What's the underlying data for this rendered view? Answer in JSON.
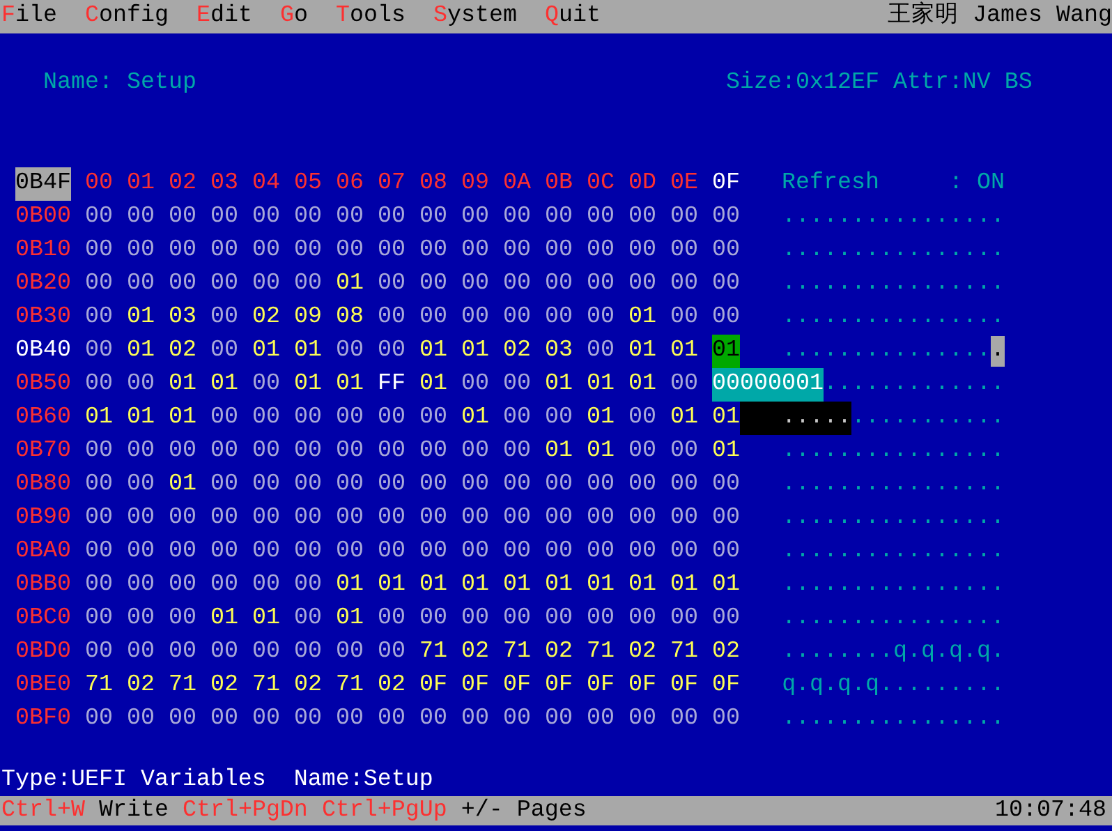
{
  "menu": [
    {
      "label": "File"
    },
    {
      "label": "Config"
    },
    {
      "label": "Edit"
    },
    {
      "label": "Go"
    },
    {
      "label": "Tools"
    },
    {
      "label": "System"
    },
    {
      "label": "Quit"
    }
  ],
  "user": "王家明 James Wang",
  "variable": {
    "name": "Name: Setup",
    "info": "Size:0x12EF Attr:NV BS"
  },
  "header": {
    "offset": "0B4F",
    "columns": [
      {
        "label": "00",
        "selected": false
      },
      {
        "label": "01",
        "selected": false
      },
      {
        "label": "02",
        "selected": false
      },
      {
        "label": "03",
        "selected": false
      },
      {
        "label": "04",
        "selected": false
      },
      {
        "label": "05",
        "selected": false
      },
      {
        "label": "06",
        "selected": false
      },
      {
        "label": "07",
        "selected": false
      },
      {
        "label": "08",
        "selected": false
      },
      {
        "label": "09",
        "selected": false
      },
      {
        "label": "0A",
        "selected": false
      },
      {
        "label": "0B",
        "selected": false
      },
      {
        "label": "0C",
        "selected": false
      },
      {
        "label": "0D",
        "selected": false
      },
      {
        "label": "0E",
        "selected": false
      },
      {
        "label": "0F",
        "selected": true
      }
    ],
    "refresh_label": "Refresh",
    "refresh_value": ": ON"
  },
  "rows": [
    {
      "offset": "0B00",
      "selected": false,
      "bytes": [
        "00",
        "00",
        "00",
        "00",
        "00",
        "00",
        "00",
        "00",
        "00",
        "00",
        "00",
        "00",
        "00",
        "00",
        "00",
        "00"
      ],
      "ascii": "................"
    },
    {
      "offset": "0B10",
      "selected": false,
      "bytes": [
        "00",
        "00",
        "00",
        "00",
        "00",
        "00",
        "00",
        "00",
        "00",
        "00",
        "00",
        "00",
        "00",
        "00",
        "00",
        "00"
      ],
      "ascii": "................"
    },
    {
      "offset": "0B20",
      "selected": false,
      "bytes": [
        "00",
        "00",
        "00",
        "00",
        "00",
        "00",
        "01",
        "00",
        "00",
        "00",
        "00",
        "00",
        "00",
        "00",
        "00",
        "00"
      ],
      "ascii": "................"
    },
    {
      "offset": "0B30",
      "selected": false,
      "bytes": [
        "00",
        "01",
        "03",
        "00",
        "02",
        "09",
        "08",
        "00",
        "00",
        "00",
        "00",
        "00",
        "00",
        "01",
        "00",
        "00"
      ],
      "ascii": "................"
    },
    {
      "offset": "0B40",
      "selected": true,
      "bytes": [
        "00",
        "01",
        "02",
        "00",
        "01",
        "01",
        "00",
        "00",
        "01",
        "01",
        "02",
        "03",
        "00",
        "01",
        "01",
        "01"
      ],
      "ascii": "................"
    },
    {
      "offset": "0B50",
      "selected": false,
      "bytes": [
        "00",
        "00",
        "01",
        "01",
        "00",
        "01",
        "01",
        "FF",
        "01",
        "00",
        "00",
        "01",
        "01",
        "01",
        "00"
      ],
      "ascii": "............."
    },
    {
      "offset": "0B60",
      "selected": false,
      "bytes": [
        "01",
        "01",
        "01",
        "00",
        "00",
        "00",
        "00",
        "00",
        "00",
        "01",
        "00",
        "00",
        "01",
        "00",
        "01",
        "01"
      ],
      "ascii": "................"
    },
    {
      "offset": "0B70",
      "selected": false,
      "bytes": [
        "00",
        "00",
        "00",
        "00",
        "00",
        "00",
        "00",
        "00",
        "00",
        "00",
        "00",
        "01",
        "01",
        "00",
        "00",
        "01"
      ],
      "ascii": "................"
    },
    {
      "offset": "0B80",
      "selected": false,
      "bytes": [
        "00",
        "00",
        "01",
        "00",
        "00",
        "00",
        "00",
        "00",
        "00",
        "00",
        "00",
        "00",
        "00",
        "00",
        "00",
        "00"
      ],
      "ascii": "................"
    },
    {
      "offset": "0B90",
      "selected": false,
      "bytes": [
        "00",
        "00",
        "00",
        "00",
        "00",
        "00",
        "00",
        "00",
        "00",
        "00",
        "00",
        "00",
        "00",
        "00",
        "00",
        "00"
      ],
      "ascii": "................"
    },
    {
      "offset": "0BA0",
      "selected": false,
      "bytes": [
        "00",
        "00",
        "00",
        "00",
        "00",
        "00",
        "00",
        "00",
        "00",
        "00",
        "00",
        "00",
        "00",
        "00",
        "00",
        "00"
      ],
      "ascii": "................"
    },
    {
      "offset": "0BB0",
      "selected": false,
      "bytes": [
        "00",
        "00",
        "00",
        "00",
        "00",
        "00",
        "01",
        "01",
        "01",
        "01",
        "01",
        "01",
        "01",
        "01",
        "01",
        "01"
      ],
      "ascii": "................"
    },
    {
      "offset": "0BC0",
      "selected": false,
      "bytes": [
        "00",
        "00",
        "00",
        "01",
        "01",
        "00",
        "01",
        "00",
        "00",
        "00",
        "00",
        "00",
        "00",
        "00",
        "00",
        "00"
      ],
      "ascii": "................"
    },
    {
      "offset": "0BD0",
      "selected": false,
      "bytes": [
        "00",
        "00",
        "00",
        "00",
        "00",
        "00",
        "00",
        "00",
        "71",
        "02",
        "71",
        "02",
        "71",
        "02",
        "71",
        "02"
      ],
      "ascii": "........q.q.q.q."
    },
    {
      "offset": "0BE0",
      "selected": false,
      "bytes": [
        "71",
        "02",
        "71",
        "02",
        "71",
        "02",
        "71",
        "02",
        "0F",
        "0F",
        "0F",
        "0F",
        "0F",
        "0F",
        "0F",
        "0F"
      ],
      "ascii": "q.q.q.q........."
    },
    {
      "offset": "0BF0",
      "selected": false,
      "bytes": [
        "00",
        "00",
        "00",
        "00",
        "00",
        "00",
        "00",
        "00",
        "00",
        "00",
        "00",
        "00",
        "00",
        "00",
        "00",
        "00"
      ],
      "ascii": "................"
    }
  ],
  "bit_popup": {
    "value": "00000001"
  },
  "status_line": "Type:UEFI Variables  Name:Setup",
  "hints": [
    {
      "kind": "key",
      "text": "Ctrl+W"
    },
    {
      "kind": "action",
      "text": "Write"
    },
    {
      "kind": "key",
      "text": "Ctrl+PgDn"
    },
    {
      "kind": "key",
      "text": "Ctrl+PgUp"
    },
    {
      "kind": "action",
      "text": "+/- Pages"
    }
  ],
  "clock": "10:07:48"
}
